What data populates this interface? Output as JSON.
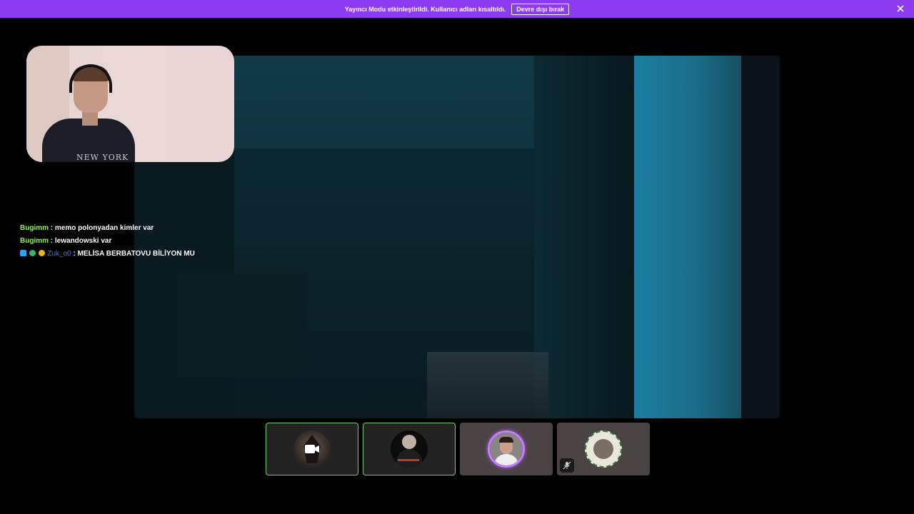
{
  "banner": {
    "message": "Yayıncı Modu etkinleştirildi. Kullanıcı adları kısaltıldı.",
    "disable_button": "Devre dışı bırak",
    "color": "#8c3bf0"
  },
  "webcam": {
    "shirt_text": "NEW YORK"
  },
  "chat": {
    "messages": [
      {
        "user": "Bugimm",
        "separator": " : ",
        "text": "memo polonyadan kimler var"
      },
      {
        "user": "Bugimm",
        "separator": " : ",
        "text": "lewandowski var"
      },
      {
        "user": "Zuk_o0",
        "separator": " : ",
        "text": "MELİSA BERBATOVU BİLİYON MU"
      }
    ]
  },
  "participants": [
    {
      "icon": "video-camera-icon",
      "state": "video-on"
    },
    {
      "icon": "avatar",
      "state": "active"
    },
    {
      "icon": "avatar",
      "state": "speaking"
    },
    {
      "icon": "avatar",
      "state": "muted"
    }
  ]
}
